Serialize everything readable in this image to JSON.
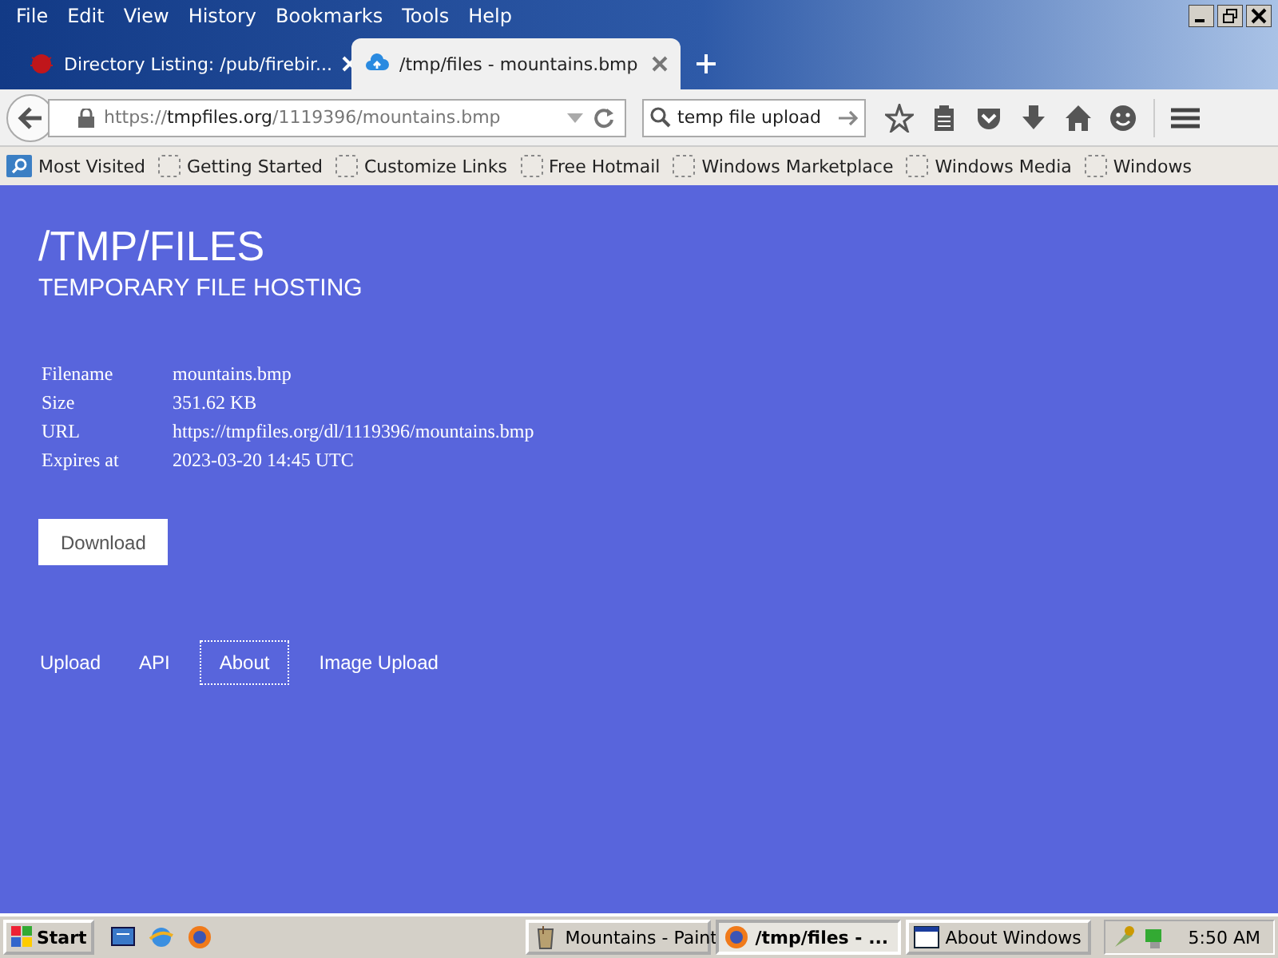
{
  "menu": [
    "File",
    "Edit",
    "View",
    "History",
    "Bookmarks",
    "Tools",
    "Help"
  ],
  "tabs": [
    {
      "title": "Directory Listing: /pub/firebir...",
      "kind": "bug",
      "selected": false
    },
    {
      "title": "/tmp/files - mountains.bmp",
      "kind": "cloud",
      "selected": true
    }
  ],
  "url": {
    "scheme": "https://",
    "host": "tmpfiles.org",
    "path": "/1119396/mountains.bmp"
  },
  "search": {
    "value": "temp file upload"
  },
  "bookmarks": [
    {
      "label": "Most Visited",
      "kind": "folder"
    },
    {
      "label": "Getting Started",
      "kind": "page"
    },
    {
      "label": "Customize Links",
      "kind": "page"
    },
    {
      "label": "Free Hotmail",
      "kind": "page"
    },
    {
      "label": "Windows Marketplace",
      "kind": "page"
    },
    {
      "label": "Windows Media",
      "kind": "page"
    },
    {
      "label": "Windows",
      "kind": "page"
    }
  ],
  "page": {
    "title": "/TMP/FILES",
    "subtitle": "TEMPORARY FILE HOSTING",
    "details": [
      {
        "label": "Filename",
        "value": "mountains.bmp"
      },
      {
        "label": "Size",
        "value": "351.62 KB"
      },
      {
        "label": "URL",
        "value": "https://tmpfiles.org/dl/1119396/mountains.bmp"
      },
      {
        "label": "Expires at",
        "value": "2023-03-20 14:45 UTC"
      }
    ],
    "button": "Download",
    "links": [
      {
        "label": "Upload",
        "focused": false
      },
      {
        "label": "API",
        "focused": false
      },
      {
        "label": "About",
        "focused": true
      },
      {
        "label": "Image Upload",
        "focused": false
      }
    ]
  },
  "taskbar": {
    "start": "Start",
    "tasks": [
      {
        "label": "Mountains - Paint",
        "kind": "paint",
        "selected": false
      },
      {
        "label": "/tmp/files - ...",
        "kind": "firefox",
        "selected": true
      },
      {
        "label": "About Windows",
        "kind": "window",
        "selected": false
      }
    ],
    "clock": "5:50 AM"
  }
}
